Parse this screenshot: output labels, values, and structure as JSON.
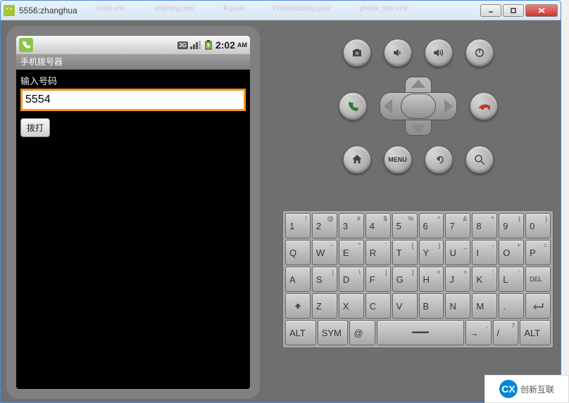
{
  "window": {
    "title": "5556:zhanghua",
    "bg_tabs": [
      "main.xml",
      "anything.xml",
      "R.java",
      "PhoneActivity.java",
      "phone_title.xml"
    ]
  },
  "status_bar": {
    "time": "2:02",
    "ampm": "AM",
    "signal_label": "3G"
  },
  "app": {
    "title": "手机拨号器",
    "input_label": "输入号码",
    "input_value": "5554",
    "dial_button_label": "拨打"
  },
  "hw_buttons": {
    "row1": [
      "camera",
      "volume-down",
      "volume-up",
      "power"
    ],
    "row2": [
      "call",
      "dpad",
      "hangup"
    ],
    "row3": [
      "home",
      "menu",
      "back",
      "search"
    ],
    "menu_label": "MENU"
  },
  "keyboard": {
    "row1": [
      {
        "main": "1",
        "sup": "!"
      },
      {
        "main": "2",
        "sup": "@"
      },
      {
        "main": "3",
        "sup": "#"
      },
      {
        "main": "4",
        "sup": "$"
      },
      {
        "main": "5",
        "sup": "%"
      },
      {
        "main": "6",
        "sup": "^"
      },
      {
        "main": "7",
        "sup": "&"
      },
      {
        "main": "8",
        "sup": "*"
      },
      {
        "main": "9",
        "sup": "("
      },
      {
        "main": "0",
        "sup": ")"
      }
    ],
    "row2": [
      {
        "main": "Q",
        "sup": ""
      },
      {
        "main": "W",
        "sup": "~"
      },
      {
        "main": "E",
        "sup": "\""
      },
      {
        "main": "R",
        "sup": "`"
      },
      {
        "main": "T",
        "sup": "{"
      },
      {
        "main": "Y",
        "sup": "}"
      },
      {
        "main": "U",
        "sup": "_"
      },
      {
        "main": "I",
        "sup": "-"
      },
      {
        "main": "O",
        "sup": "+"
      },
      {
        "main": "P",
        "sup": "="
      }
    ],
    "row3": [
      {
        "main": "A",
        "sup": ""
      },
      {
        "main": "S",
        "sup": "|"
      },
      {
        "main": "D",
        "sup": "\\"
      },
      {
        "main": "F",
        "sup": "["
      },
      {
        "main": "G",
        "sup": "]"
      },
      {
        "main": "H",
        "sup": "<"
      },
      {
        "main": "J",
        "sup": ">"
      },
      {
        "main": "K",
        "sup": ";"
      },
      {
        "main": "L",
        "sup": ":"
      },
      {
        "main": "DEL",
        "sup": ""
      }
    ],
    "row4": [
      {
        "main": "⇧",
        "sup": ""
      },
      {
        "main": "Z",
        "sup": ""
      },
      {
        "main": "X",
        "sup": ""
      },
      {
        "main": "C",
        "sup": ""
      },
      {
        "main": "V",
        "sup": ""
      },
      {
        "main": "B",
        "sup": ""
      },
      {
        "main": "N",
        "sup": ""
      },
      {
        "main": "M",
        "sup": ""
      },
      {
        "main": ".",
        "sup": ""
      },
      {
        "main": "↵",
        "sup": ""
      }
    ],
    "row5": [
      {
        "main": "ALT",
        "sup": ""
      },
      {
        "main": "SYM",
        "sup": ""
      },
      {
        "main": "@",
        "sup": ""
      },
      {
        "main": "",
        "sup": "",
        "wide": "space"
      },
      {
        "main": "→",
        "sup": ","
      },
      {
        "main": "/",
        "sup": "?"
      },
      {
        "main": "ALT",
        "sup": ""
      }
    ]
  },
  "watermark": {
    "logo": "CX",
    "text": "创新互联"
  }
}
